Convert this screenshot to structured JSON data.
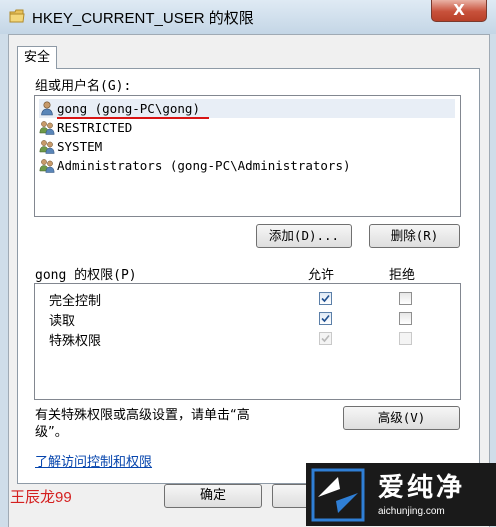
{
  "window": {
    "title": "HKEY_CURRENT_USER 的权限",
    "close_glyph": "X"
  },
  "tabs": [
    {
      "label": "安全"
    }
  ],
  "security": {
    "group_label": "组或用户名(G):",
    "users": [
      {
        "name": "gong (gong-PC\\gong)",
        "icon": "user-icon",
        "selected": true
      },
      {
        "name": "RESTRICTED",
        "icon": "group-icon"
      },
      {
        "name": "SYSTEM",
        "icon": "group-icon"
      },
      {
        "name": "Administrators (gong-PC\\Administrators)",
        "icon": "group-icon"
      }
    ],
    "add_button": "添加(D)...",
    "remove_button": "删除(R)",
    "permissions_for": "gong 的权限(P)",
    "allow_header": "允许",
    "deny_header": "拒绝",
    "permissions": [
      {
        "name": "完全控制",
        "allow": true,
        "deny": false,
        "disabled": false
      },
      {
        "name": "读取",
        "allow": true,
        "deny": false,
        "disabled": false
      },
      {
        "name": "特殊权限",
        "allow": true,
        "deny": false,
        "disabled": true
      }
    ],
    "advanced_note_line1": "有关特殊权限或高级设置，请单击“高",
    "advanced_note_line2": "级”。",
    "advanced_button": "高级(V)",
    "learn_link": "了解访问控制和权限"
  },
  "footer": {
    "ok_button": "确定"
  },
  "overlay": {
    "watermark": "王辰龙99",
    "logo_main": "爱纯净",
    "logo_sub": "aichunjing.com"
  },
  "colors": {
    "accent_red": "#d81414",
    "link": "#0645ad",
    "titlebar": "#cfdde9"
  }
}
